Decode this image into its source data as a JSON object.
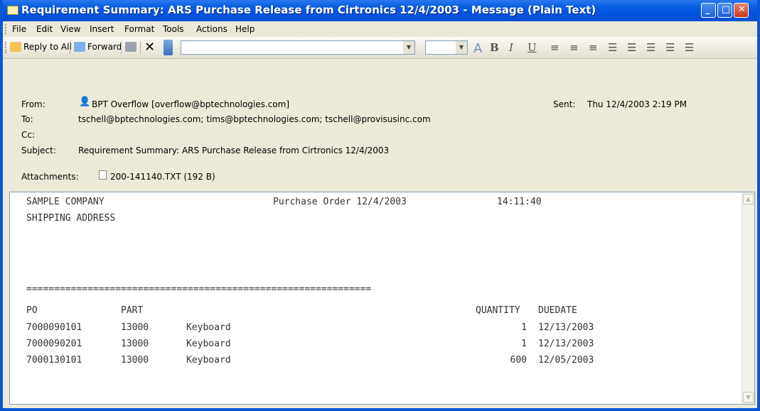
{
  "window": {
    "title": "Requirement Summary: ARS Purchase Release from Cirtronics 12/4/2003 - Message (Plain Text)"
  },
  "menu": [
    "File",
    "Edit",
    "View",
    "Insert",
    "Format",
    "Tools",
    "Actions",
    "Help"
  ],
  "toolbar": {
    "reply_all": "Reply to All",
    "forward": "Forward"
  },
  "header": {
    "from_label": "From:",
    "from_value": "BPT Overflow [overflow@bptechnologies.com]",
    "sent_label": "Sent:",
    "sent_value": "Thu 12/4/2003 2:19 PM",
    "to_label": "To:",
    "to_value": "tschell@bptechnologies.com; tims@bptechnologies.com; tschell@provisusinc.com",
    "cc_label": "Cc:",
    "cc_value": "",
    "subject_label": "Subject:",
    "subject_value": "Requirement Summary: ARS Purchase Release from Cirtronics 12/4/2003",
    "attachments_label": "Attachments:",
    "attachment_file": "200-141140.TXT (192 B)"
  },
  "body": {
    "company": "SAMPLE COMPANY",
    "po_title": "Purchase Order 12/4/2003",
    "time": "14:11:40",
    "shipping": "SHIPPING ADDRESS",
    "divider": "==============================================================",
    "columns": {
      "po": "PO",
      "part": "PART",
      "quantity": "QUANTITY",
      "duedate": "DUEDATE"
    },
    "rows": [
      {
        "po": "7000090101",
        "part": "13000",
        "desc": "Keyboard",
        "qty": "1",
        "due": "12/13/2003"
      },
      {
        "po": "7000090201",
        "part": "13000",
        "desc": "Keyboard",
        "qty": "1",
        "due": "12/13/2003"
      },
      {
        "po": "7000130101",
        "part": "13000",
        "desc": "Keyboard",
        "qty": "600",
        "due": "12/05/2003"
      }
    ]
  }
}
